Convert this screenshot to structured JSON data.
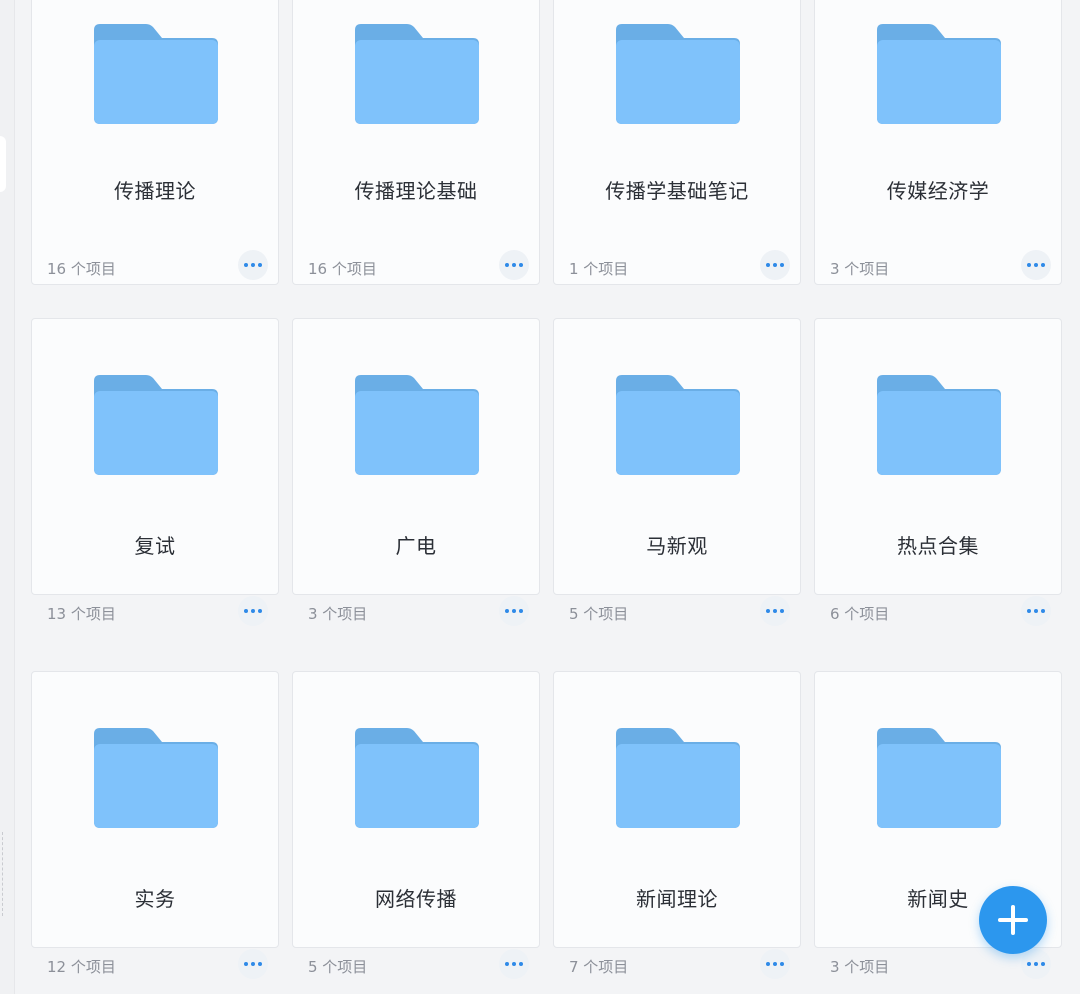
{
  "colors": {
    "folder_body": "#7fc2fb",
    "folder_tab": "#6aaee6",
    "accent": "#2c97ee"
  },
  "folders": [
    {
      "name": "传播理论",
      "count": "16 个项目"
    },
    {
      "name": "传播理论基础",
      "count": "16 个项目"
    },
    {
      "name": "传播学基础笔记",
      "count": "1 个项目"
    },
    {
      "name": "传媒经济学",
      "count": "3 个项目"
    },
    {
      "name": "复试",
      "count": "13 个项目"
    },
    {
      "name": "广电",
      "count": "3 个项目"
    },
    {
      "name": "马新观",
      "count": "5 个项目"
    },
    {
      "name": "热点合集",
      "count": "6 个项目"
    },
    {
      "name": "实务",
      "count": "12 个项目"
    },
    {
      "name": "网络传播",
      "count": "5 个项目"
    },
    {
      "name": "新闻理论",
      "count": "7 个项目"
    },
    {
      "name": "新闻史",
      "count": "3 个项目"
    }
  ],
  "fab": {
    "icon": "plus-icon"
  }
}
